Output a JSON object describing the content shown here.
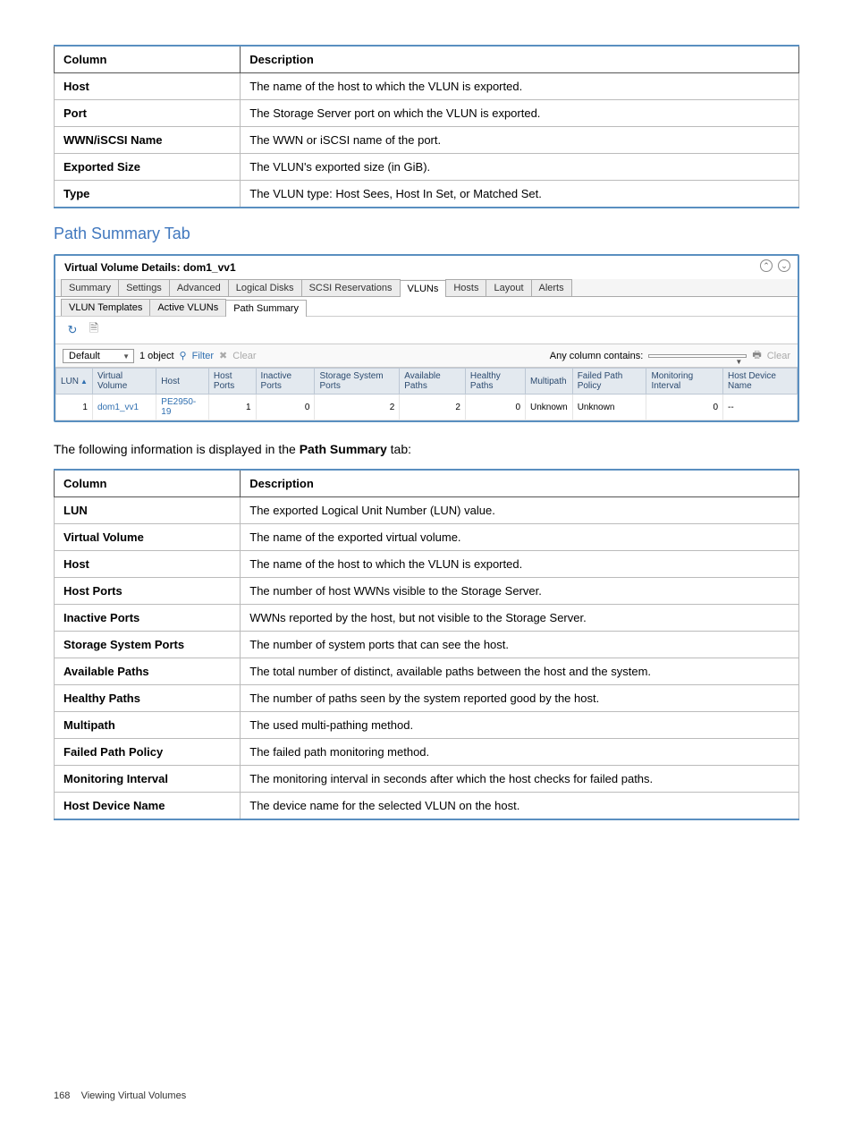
{
  "top_table": {
    "headers": [
      "Column",
      "Description"
    ],
    "rows": [
      [
        "Host",
        "The name of the host to which the VLUN is exported."
      ],
      [
        "Port",
        "The Storage Server port on which the VLUN is exported."
      ],
      [
        "WWN/iSCSI Name",
        "The WWN or iSCSI name of the port."
      ],
      [
        "Exported Size",
        "The VLUN's exported size (in GiB)."
      ],
      [
        "Type",
        "The VLUN type: Host Sees, Host In Set, or Matched Set."
      ]
    ]
  },
  "section_heading": "Path Summary Tab",
  "panel": {
    "title": "Virtual Volume Details: dom1_vv1",
    "main_tabs": [
      "Summary",
      "Settings",
      "Advanced",
      "Logical Disks",
      "SCSI Reservations",
      "VLUNs",
      "Hosts",
      "Layout",
      "Alerts"
    ],
    "main_tab_active_index": 5,
    "sub_tabs": [
      "VLUN Templates",
      "Active VLUNs",
      "Path Summary"
    ],
    "sub_tab_active_index": 2,
    "filter": {
      "combo_value": "Default",
      "object_count": "1 object",
      "filter_label": "Filter",
      "clear_label": "Clear",
      "right_label": "Any column contains:",
      "right_combo_value": "",
      "printer_label": "",
      "clear_right_label": "Clear"
    },
    "grid": {
      "columns": [
        "LUN",
        "Virtual Volume",
        "Host",
        "Host Ports",
        "Inactive Ports",
        "Storage System Ports",
        "Available Paths",
        "Healthy Paths",
        "Multipath",
        "Failed Path Policy",
        "Monitoring Interval",
        "Host Device Name"
      ],
      "row": {
        "lun": "1",
        "virtual_volume": "dom1_vv1",
        "host": "PE2950-19",
        "host_ports": "1",
        "inactive_ports": "0",
        "storage_system_ports": "2",
        "available_paths": "2",
        "healthy_paths": "0",
        "multipath": "Unknown",
        "failed_path_policy": "Unknown",
        "monitoring_interval": "0",
        "host_device_name": "--"
      }
    }
  },
  "lead_text_prefix": "The following information is displayed in the ",
  "lead_text_bold": "Path Summary",
  "lead_text_suffix": " tab:",
  "bottom_table": {
    "headers": [
      "Column",
      "Description"
    ],
    "rows": [
      [
        "LUN",
        "The exported Logical Unit Number (LUN) value."
      ],
      [
        "Virtual Volume",
        "The name of the exported virtual volume."
      ],
      [
        "Host",
        "The name of the host to which the VLUN is exported."
      ],
      [
        "Host Ports",
        "The number of host WWNs visible to the Storage Server."
      ],
      [
        "Inactive Ports",
        "WWNs reported by the host, but not visible to the Storage Server."
      ],
      [
        "Storage System Ports",
        "The number of system ports that can see the host."
      ],
      [
        "Available Paths",
        "The total number of distinct, available paths between the host and the system."
      ],
      [
        "Healthy Paths",
        "The number of paths seen by the system reported good by the host."
      ],
      [
        "Multipath",
        "The used multi-pathing method."
      ],
      [
        "Failed Path Policy",
        "The failed path monitoring method."
      ],
      [
        "Monitoring Interval",
        "The monitoring interval in seconds after which the host checks for failed paths."
      ],
      [
        "Host Device Name",
        "The device name for the selected VLUN on the host."
      ]
    ]
  },
  "footer": {
    "page_number": "168",
    "page_title": "Viewing Virtual Volumes"
  }
}
